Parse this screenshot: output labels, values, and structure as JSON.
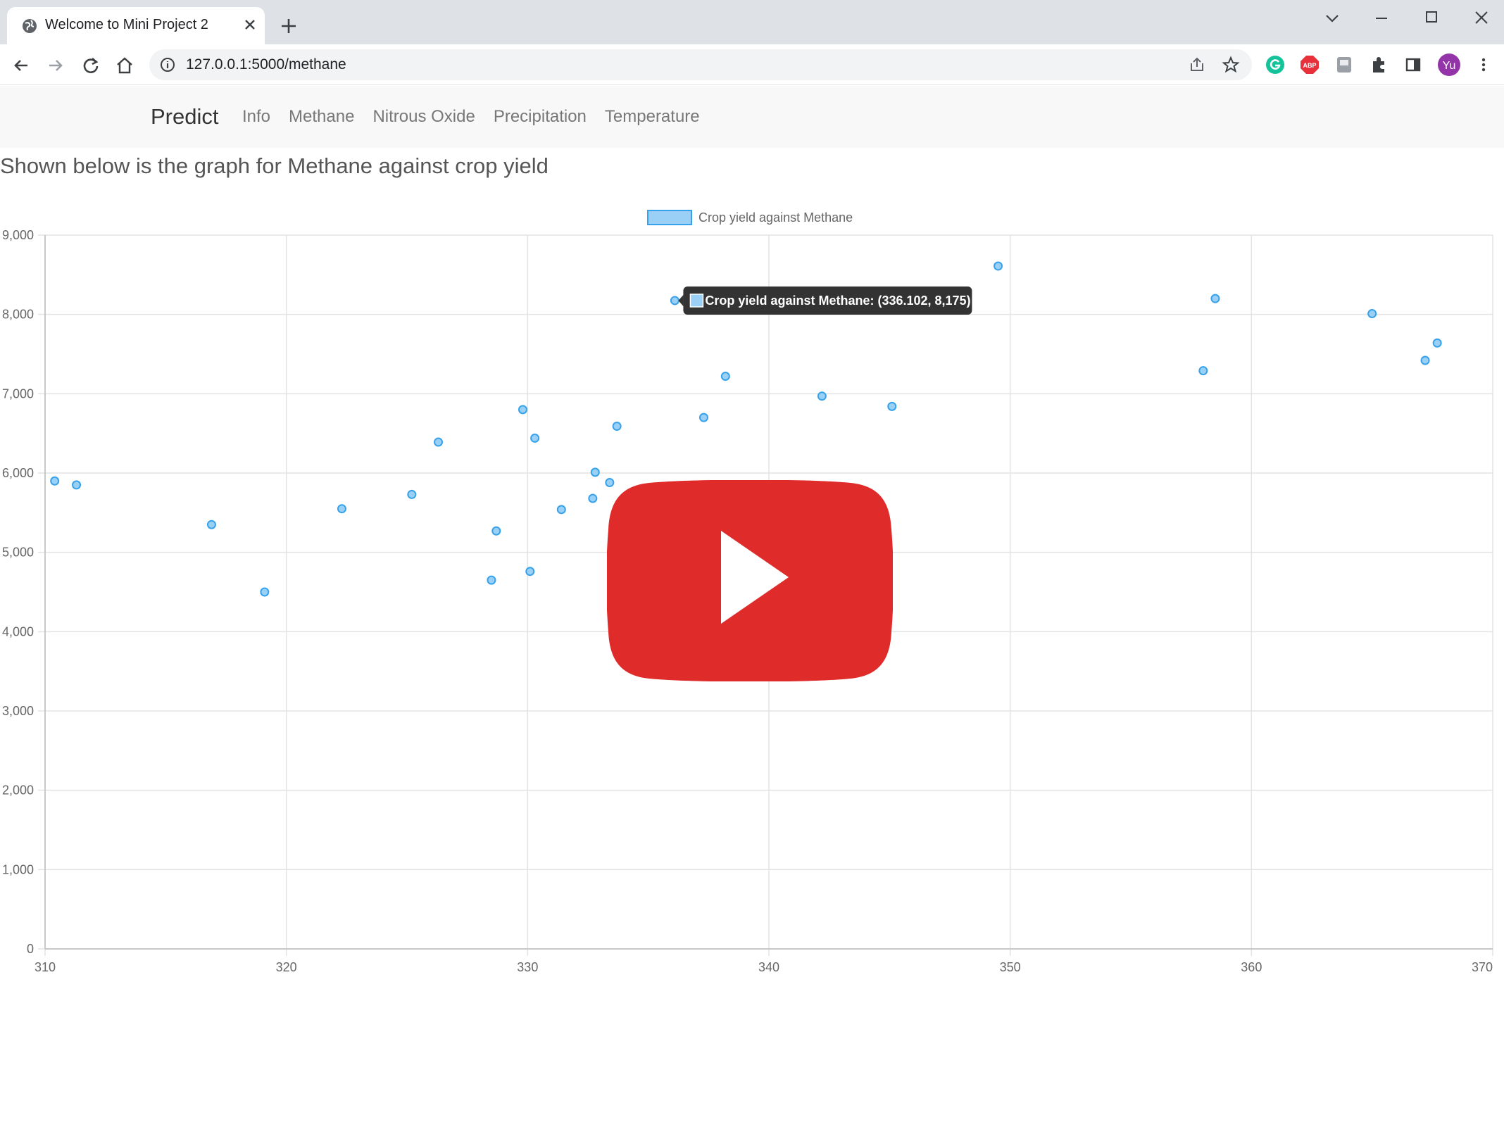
{
  "browser": {
    "tab_title": "Welcome to Mini Project 2",
    "url": "127.0.0.1:5000/methane",
    "profile_initials": "Yu",
    "abp_label": "ABP"
  },
  "navbar": {
    "brand": "Predict",
    "links": [
      "Info",
      "Methane",
      "Nitrous Oxide",
      "Precipitation",
      "Temperature"
    ]
  },
  "page": {
    "heading": "Shown below is the graph for Methane against crop yield"
  },
  "chart_data": {
    "type": "scatter",
    "series": [
      {
        "name": "Crop yield against Methane",
        "color": "#36a2eb",
        "points": [
          [
            310.4,
            5900
          ],
          [
            311.3,
            5850
          ],
          [
            316.9,
            5350
          ],
          [
            319.1,
            4500
          ],
          [
            322.3,
            5550
          ],
          [
            325.2,
            5730
          ],
          [
            326.3,
            6390
          ],
          [
            328.5,
            4650
          ],
          [
            328.7,
            5270
          ],
          [
            329.8,
            6800
          ],
          [
            330.1,
            4760
          ],
          [
            330.3,
            6440
          ],
          [
            331.4,
            5540
          ],
          [
            332.7,
            5680
          ],
          [
            332.8,
            6010
          ],
          [
            333.4,
            5880
          ],
          [
            333.7,
            6590
          ],
          [
            336.102,
            8175
          ],
          [
            337.3,
            6700
          ],
          [
            338.2,
            7220
          ],
          [
            342.2,
            6970
          ],
          [
            345.1,
            6840
          ],
          [
            349.5,
            8610
          ],
          [
            358.0,
            7290
          ],
          [
            358.5,
            8200
          ],
          [
            365.0,
            8010
          ],
          [
            367.2,
            7420
          ],
          [
            367.7,
            7640
          ]
        ]
      }
    ],
    "xlim": [
      310,
      370
    ],
    "ylim": [
      0,
      9000
    ],
    "x_ticks": [
      "310",
      "320",
      "330",
      "340",
      "350",
      "360",
      "370"
    ],
    "y_ticks": [
      "0",
      "1,000",
      "2,000",
      "3,000",
      "4,000",
      "5,000",
      "6,000",
      "7,000",
      "8,000",
      "9,000"
    ],
    "legend": "top-center",
    "grid": true,
    "tooltip": {
      "text": "Crop yield against Methane: (336.102, 8,175)",
      "point": [
        336.102,
        8175
      ]
    }
  }
}
